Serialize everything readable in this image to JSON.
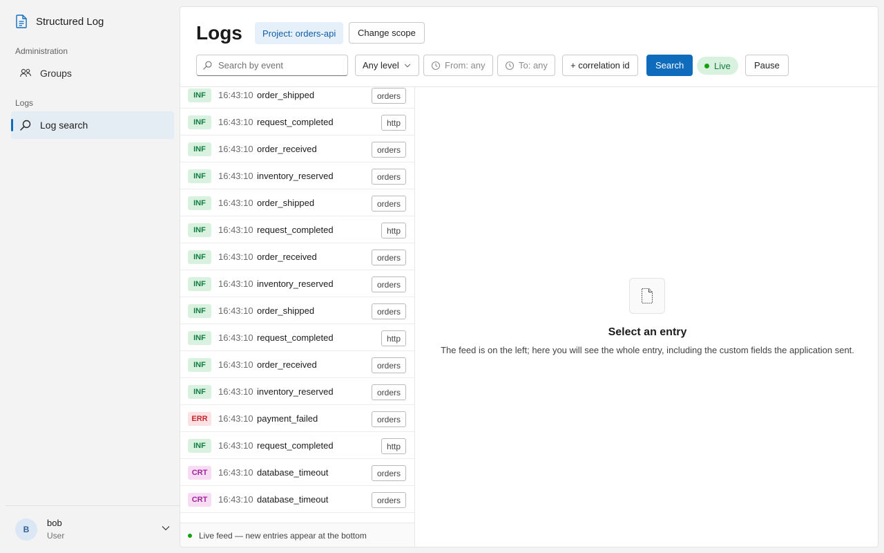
{
  "sidebar": {
    "app_title": "Structured Log",
    "sections": [
      {
        "label": "Administration",
        "items": [
          {
            "label": "Groups",
            "icon": "people-icon"
          }
        ]
      },
      {
        "label": "Logs",
        "items": [
          {
            "label": "Log search",
            "icon": "search-icon",
            "active": true
          }
        ]
      }
    ],
    "user": {
      "initial": "B",
      "name": "bob",
      "role": "User"
    }
  },
  "header": {
    "title": "Logs",
    "project_badge": "Project: orders-api",
    "change_scope": "Change scope"
  },
  "filters": {
    "search_placeholder": "Search by event",
    "level": "Any level",
    "from": "From: any",
    "to": "To: any",
    "correlation": "+ correlation id",
    "search_button": "Search",
    "live": "Live",
    "pause": "Pause"
  },
  "logs": [
    {
      "level": "INF",
      "time": "16:43:10",
      "event": "order_shipped",
      "tag": "orders"
    },
    {
      "level": "INF",
      "time": "16:43:10",
      "event": "request_completed",
      "tag": "http"
    },
    {
      "level": "INF",
      "time": "16:43:10",
      "event": "order_received",
      "tag": "orders"
    },
    {
      "level": "INF",
      "time": "16:43:10",
      "event": "inventory_reserved",
      "tag": "orders"
    },
    {
      "level": "INF",
      "time": "16:43:10",
      "event": "order_shipped",
      "tag": "orders"
    },
    {
      "level": "INF",
      "time": "16:43:10",
      "event": "request_completed",
      "tag": "http"
    },
    {
      "level": "INF",
      "time": "16:43:10",
      "event": "order_received",
      "tag": "orders"
    },
    {
      "level": "INF",
      "time": "16:43:10",
      "event": "inventory_reserved",
      "tag": "orders"
    },
    {
      "level": "INF",
      "time": "16:43:10",
      "event": "order_shipped",
      "tag": "orders"
    },
    {
      "level": "INF",
      "time": "16:43:10",
      "event": "request_completed",
      "tag": "http"
    },
    {
      "level": "INF",
      "time": "16:43:10",
      "event": "order_received",
      "tag": "orders"
    },
    {
      "level": "INF",
      "time": "16:43:10",
      "event": "inventory_reserved",
      "tag": "orders"
    },
    {
      "level": "ERR",
      "time": "16:43:10",
      "event": "payment_failed",
      "tag": "orders"
    },
    {
      "level": "INF",
      "time": "16:43:10",
      "event": "request_completed",
      "tag": "http"
    },
    {
      "level": "CRT",
      "time": "16:43:10",
      "event": "database_timeout",
      "tag": "orders"
    },
    {
      "level": "CRT",
      "time": "16:43:10",
      "event": "database_timeout",
      "tag": "orders"
    }
  ],
  "live_footer": "Live feed — new entries appear at the bottom",
  "detail": {
    "title": "Select an entry",
    "description": "The feed is on the left; here you will see the whole entry, including the custom fields the application sent."
  },
  "colors": {
    "accent": "#0f6cbd",
    "inf": "#107c41",
    "err": "#c4262e",
    "crt": "#a0259a"
  }
}
